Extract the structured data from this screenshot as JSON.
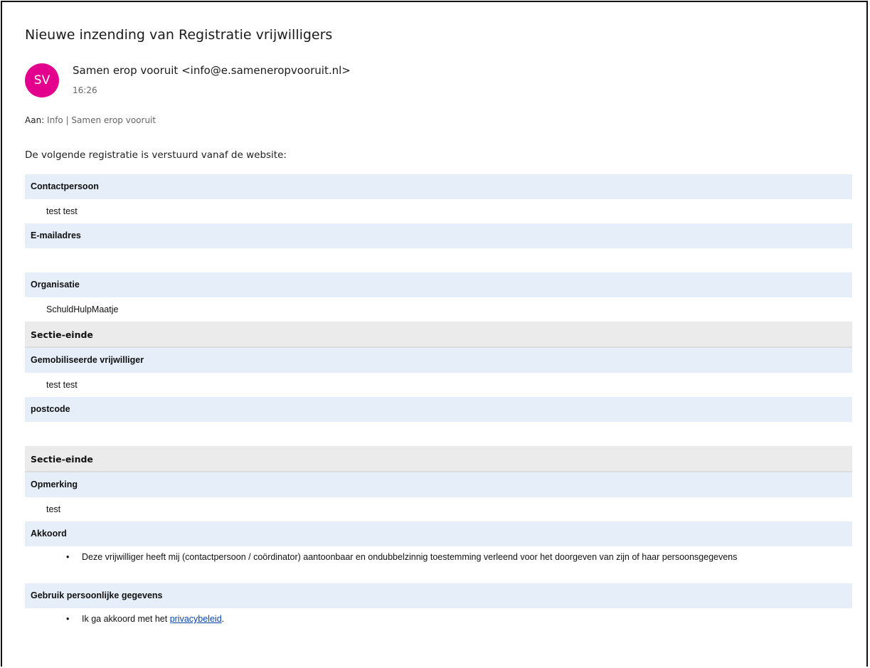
{
  "email": {
    "subject": "Nieuwe inzending van Registratie vrijwilligers",
    "avatar_initials": "SV",
    "avatar_color": "#e3008c",
    "sender": "Samen erop vooruit <info@e.sameneropvooruit.nl>",
    "time": "16:26",
    "to_label": "Aan:",
    "to_value": "Info | Samen erop vooruit",
    "intro": "De volgende registratie is verstuurd vanaf de website:"
  },
  "form": {
    "contactpersoon_label": "Contactpersoon",
    "contactpersoon_value": "test test",
    "email_label": "E-mailadres",
    "email_value": "",
    "organisatie_label": "Organisatie",
    "organisatie_value": "SchuldHulpMaatje",
    "section_end_1": "Sectie-einde",
    "vrijwilliger_label": "Gemobiliseerde vrijwilliger",
    "vrijwilliger_value": "test test",
    "postcode_label": "postcode",
    "postcode_value": "",
    "section_end_2": "Sectie-einde",
    "opmerking_label": "Opmerking",
    "opmerking_value": "test",
    "akkoord_label": "Akkoord",
    "akkoord_value": "Deze vrijwilliger heeft mij (contactpersoon / coördinator) aantoonbaar en ondubbelzinnig toestemming verleend voor het doorgeven van zijn of haar persoonsgegevens",
    "gebruik_label": "Gebruik persoonlijke gegevens",
    "gebruik_prefix": "Ik ga akkoord met het ",
    "gebruik_link": "privacybeleid",
    "gebruik_suffix": ".",
    "bullet": "•"
  }
}
